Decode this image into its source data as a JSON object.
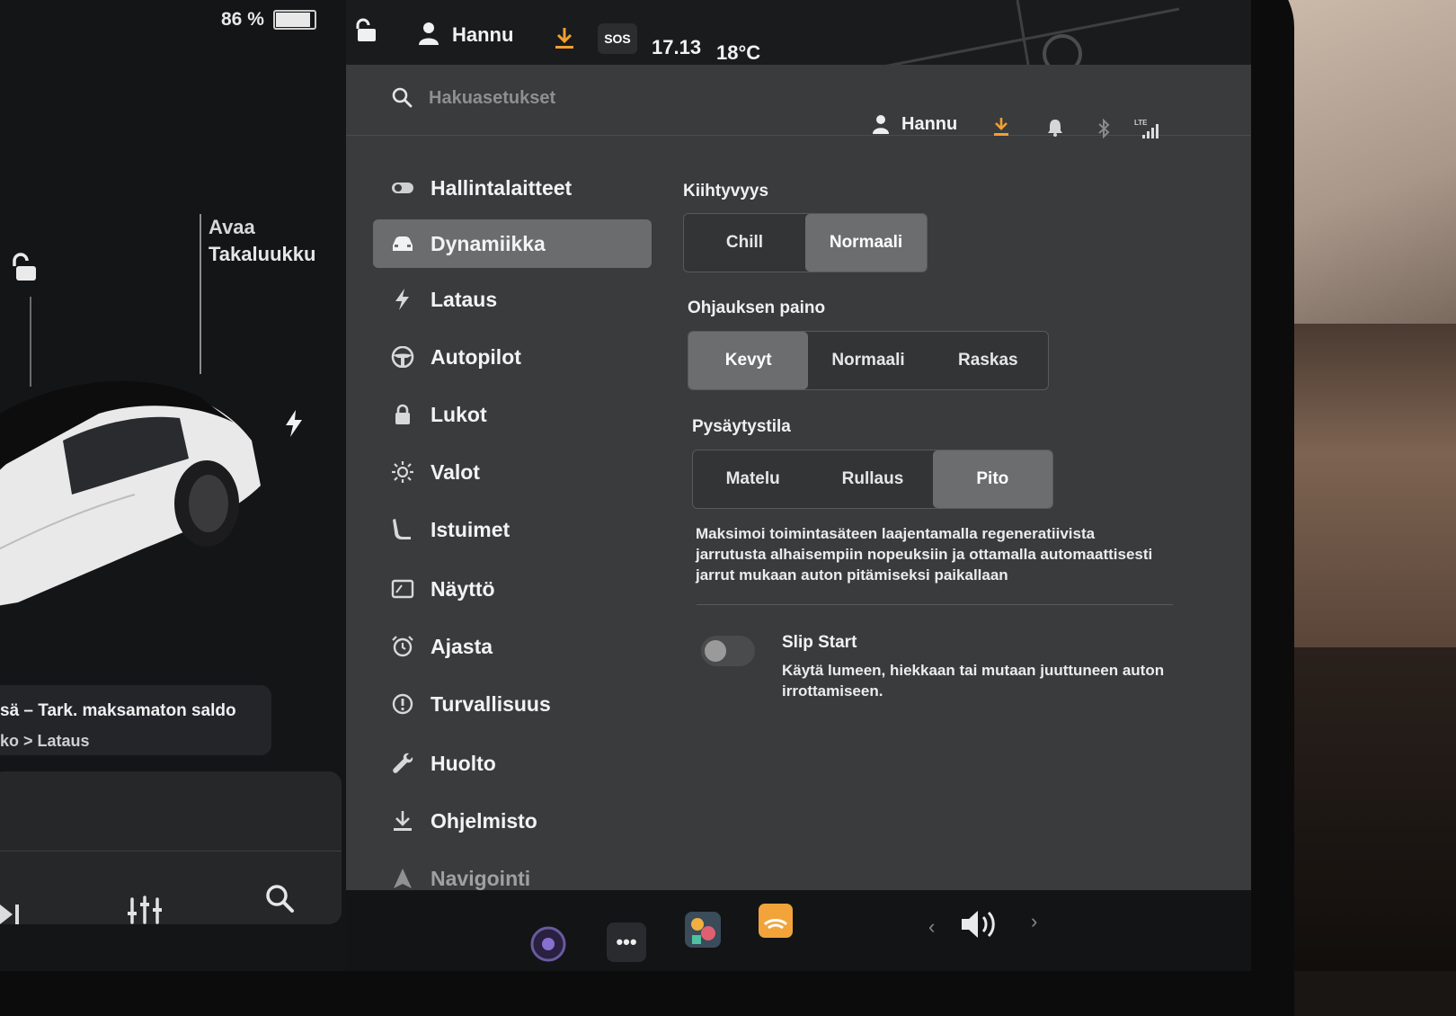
{
  "status_bar": {
    "battery_percent": "86 %",
    "battery_level": 0.86,
    "user": "Hannu",
    "sos": "SOS",
    "time": "17.13",
    "temperature": "18°C"
  },
  "car": {
    "trunk_action": "Avaa",
    "trunk_name": "Takaluukku",
    "alert_title": "sä – Tark. maksamaton saldo",
    "alert_path": "ko > Lataus"
  },
  "settings": {
    "search_placeholder": "Hakuasetukset",
    "header_user": "Hannu",
    "header_lte": "LTE",
    "nav": [
      {
        "label": "Hallintalaitteet",
        "icon": "toggle-icon"
      },
      {
        "label": "Dynamiikka",
        "icon": "car-icon",
        "active": true
      },
      {
        "label": "Lataus",
        "icon": "bolt-icon"
      },
      {
        "label": "Autopilot",
        "icon": "steering-wheel-icon"
      },
      {
        "label": "Lukot",
        "icon": "lock-icon"
      },
      {
        "label": "Valot",
        "icon": "sun-icon"
      },
      {
        "label": "Istuimet",
        "icon": "seat-icon"
      },
      {
        "label": "Näyttö",
        "icon": "display-icon"
      },
      {
        "label": "Ajasta",
        "icon": "alarm-clock-icon"
      },
      {
        "label": "Turvallisuus",
        "icon": "alert-circle-icon"
      },
      {
        "label": "Huolto",
        "icon": "wrench-icon"
      },
      {
        "label": "Ohjelmisto",
        "icon": "download-icon"
      },
      {
        "label": "Navigointi",
        "icon": "navigation-icon"
      }
    ],
    "acceleration": {
      "title": "Kiihtyvyys",
      "options": [
        "Chill",
        "Normaali"
      ],
      "selected": "Normaali"
    },
    "steering": {
      "title": "Ohjauksen paino",
      "options": [
        "Kevyt",
        "Normaali",
        "Raskas"
      ],
      "selected": "Kevyt"
    },
    "stopping": {
      "title": "Pysäytystila",
      "options": [
        "Matelu",
        "Rullaus",
        "Pito"
      ],
      "selected": "Pito",
      "description": "Maksimoi toimintasäteen laajentamalla regeneratiivista jarrutusta alhaisempiin nopeuksiin ja ottamalla automaattisesti jarrut mukaan auton pitämiseksi paikallaan"
    },
    "slip_start": {
      "title": "Slip Start",
      "description": "Käytä lumeen, hiekkaan tai mutaan juuttuneen auton irrottamiseen.",
      "enabled": false
    }
  },
  "colors": {
    "accent_orange": "#f0a030",
    "selected_segment": "#6c6d6f",
    "panel_bg": "#3a3b3d"
  }
}
